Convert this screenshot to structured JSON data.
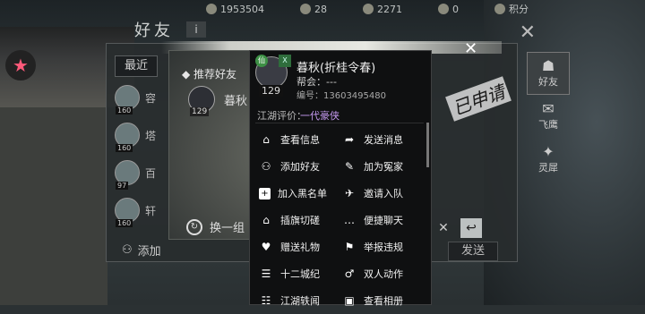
{
  "resources": [
    "1953504",
    "28",
    "2271",
    "0",
    "积分"
  ],
  "friends_panel": {
    "title": "好友",
    "info_label": "i",
    "tab_recent": "最近",
    "friends": [
      {
        "label": "容",
        "level": "160"
      },
      {
        "label": "塔",
        "level": "160"
      },
      {
        "label": "百",
        "level": "97"
      },
      {
        "label": "轩",
        "level": "160"
      }
    ],
    "add_label": "添加",
    "send_label": "发送"
  },
  "side_tabs": [
    {
      "label": "好友",
      "glyph": "☗"
    },
    {
      "label": "飞鹰",
      "glyph": "✉"
    },
    {
      "label": "灵犀",
      "glyph": "✦"
    }
  ],
  "recommend": {
    "title": "推荐好友",
    "name": "暮秋",
    "level": "129",
    "stamp": "已申请",
    "swap_label": "换一组"
  },
  "popup": {
    "name": "暮秋(折桂令春)",
    "guild": "帮会：---",
    "id": "编号：13603495480",
    "level": "129",
    "badge_a": "仙",
    "badge_b": "X",
    "reputation_label": "江湖评价：",
    "reputation_value": "一代豪侠",
    "actions": [
      {
        "label": "查看信息",
        "icon": "house-icon",
        "glyph": "⌂"
      },
      {
        "label": "发送消息",
        "icon": "arrow-icon",
        "glyph": "➦"
      },
      {
        "label": "添加好友",
        "icon": "user-add-icon",
        "glyph": "⚇"
      },
      {
        "label": "加为冤家",
        "icon": "sword-icon",
        "glyph": "✎"
      },
      {
        "label": "加入黑名单",
        "icon": "plus-square-icon",
        "glyph": "+"
      },
      {
        "label": "邀请入队",
        "icon": "invite-icon",
        "glyph": "✈"
      },
      {
        "label": "插旗切磋",
        "icon": "flag-icon",
        "glyph": "⌂"
      },
      {
        "label": "便捷聊天",
        "icon": "chat-icon",
        "glyph": "…"
      },
      {
        "label": "赠送礼物",
        "icon": "heart-icon",
        "glyph": "♥"
      },
      {
        "label": "举报违规",
        "icon": "report-icon",
        "glyph": "⚑"
      },
      {
        "label": "十二城纪",
        "icon": "city-icon",
        "glyph": "☰"
      },
      {
        "label": "双人动作",
        "icon": "pair-icon",
        "glyph": "♂"
      },
      {
        "label": "江湖轶闻",
        "icon": "news-icon",
        "glyph": "☷"
      },
      {
        "label": "查看相册",
        "icon": "album-icon",
        "glyph": "▣"
      }
    ]
  }
}
